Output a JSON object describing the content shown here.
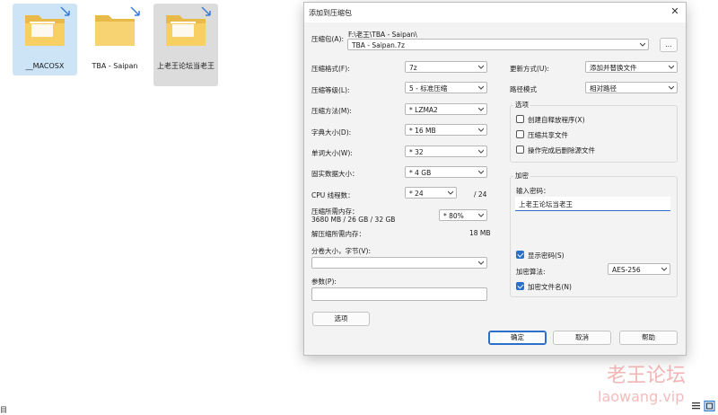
{
  "desktop": {
    "items": [
      {
        "label": "__MACOSX",
        "state": "selected"
      },
      {
        "label": "TBA - Saipan",
        "state": "normal"
      },
      {
        "label": "上老王论坛当老王",
        "state": "selected-inactive"
      }
    ],
    "status_left_text": "目"
  },
  "dialog": {
    "title": "添加到压缩包",
    "archive_label": "压缩包(A):",
    "archive_path": "F:\\老王\\TBA - Saipan\\",
    "archive_name": "TBA - Saipan.7z",
    "browse_label": "...",
    "format_label": "压缩格式(F):",
    "format_value": "7z",
    "level_label": "压缩等级(L):",
    "level_value": "5 - 标准压缩",
    "method_label": "压缩方法(M):",
    "method_value": "* LZMA2",
    "dict_label": "字典大小(D):",
    "dict_value": "* 16 MB",
    "word_label": "单词大小(W):",
    "word_value": "* 32",
    "solid_label": "固实数据大小：",
    "solid_value": "* 4 GB",
    "cpu_label": "CPU 线程数：",
    "cpu_value": "* 24",
    "cpu_total": "/ 24",
    "mem_label": "压缩所需内存：",
    "mem_values": "3680 MB / 26 GB / 32 GB",
    "mem_percent": "* 80%",
    "decomp_label": "解压缩所需内存：",
    "decomp_value": "18 MB",
    "split_label": "分卷大小，字节(V):",
    "split_value": "",
    "params_label": "参数(P):",
    "params_value": "",
    "options_button": "选项",
    "update_label": "更新方式(U):",
    "update_value": "添加并替换文件",
    "path_label": "路径模式",
    "path_value": "相对路径",
    "options_group": "选项",
    "opt_sfx": "创建自释放程序(X)",
    "opt_shared": "压缩共享文件",
    "opt_delete": "操作完成后删除源文件",
    "encrypt_group": "加密",
    "password_label": "输入密码：",
    "password_value": "上老王论坛当老王",
    "show_password": "显示密码(S)",
    "enc_method_label": "加密算法:",
    "enc_method_value": "AES-256",
    "enc_names": "加密文件名(N)",
    "ok": "确定",
    "cancel": "取消",
    "help": "帮助"
  },
  "watermark": {
    "line1": "老王论坛",
    "line2": "laowang.vip"
  }
}
